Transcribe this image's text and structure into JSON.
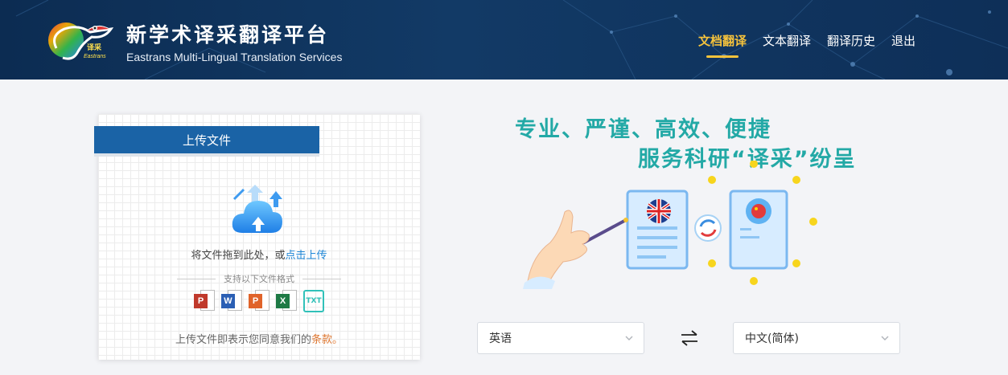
{
  "header": {
    "logo_text": "译采",
    "logo_sub": "Eastrans",
    "title": "新学术译采翻译平台",
    "subtitle": "Eastrans Multi-Lingual Translation Services",
    "nav": [
      {
        "label": "文档翻译",
        "active": true
      },
      {
        "label": "文本翻译",
        "active": false
      },
      {
        "label": "翻译历史",
        "active": false
      },
      {
        "label": "退出",
        "active": false
      }
    ]
  },
  "upload": {
    "tab_label": "上传文件",
    "drop_text": "将文件拖到此处，或",
    "drop_link": "点击上传",
    "formats_title": "支持以下文件格式",
    "formats": [
      "pdf-icon",
      "word-icon",
      "ppt-icon",
      "excel-icon",
      "txt-icon"
    ],
    "terms_text": "上传文件即表示您同意我们的",
    "terms_link": "条款。"
  },
  "promo": {
    "slogan_line1": "专业、严谨、高效、便捷",
    "slogan_line2": "服务科研“译采”纷呈"
  },
  "translate": {
    "source_lang": "英语",
    "target_lang": "中文(简体)"
  },
  "colors": {
    "header_bg": "#0e2f58",
    "nav_active": "#f6c33c",
    "tab_blue": "#1a63a6",
    "slogan_teal": "#23a9a6",
    "link_blue": "#1e86d6",
    "terms_orange": "#e07a35"
  }
}
